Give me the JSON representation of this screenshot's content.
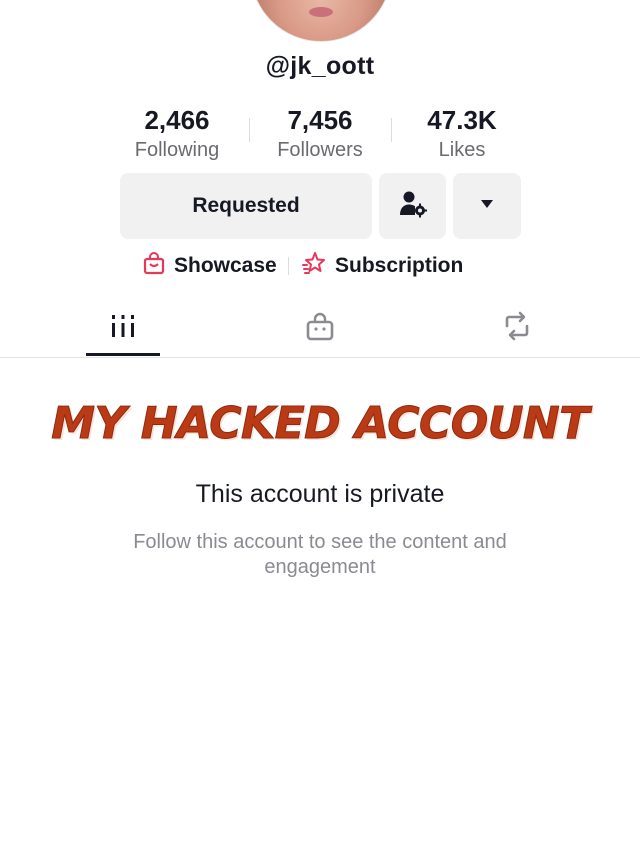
{
  "profile": {
    "username": "@jk_oott"
  },
  "stats": [
    {
      "value": "2,466",
      "label": "Following"
    },
    {
      "value": "7,456",
      "label": "Followers"
    },
    {
      "value": "47.3K",
      "label": "Likes"
    }
  ],
  "actions": {
    "requested_label": "Requested",
    "friend_settings_icon": "person-gear-icon",
    "more_icon": "caret-down-icon"
  },
  "links": {
    "showcase_label": "Showcase",
    "subscription_label": "Subscription",
    "showcase_color": "#e8385a",
    "subscription_color": "#e8385a"
  },
  "tabs": [
    {
      "icon": "videos-grid-icon",
      "active": true
    },
    {
      "icon": "shop-bag-icon",
      "active": false
    },
    {
      "icon": "repost-icon",
      "active": false
    }
  ],
  "overlay": {
    "caption": "MY HACKED ACCOUNT",
    "color": "#bb3a16"
  },
  "private_notice": {
    "title": "This account is private",
    "description": "Follow this account to see the content and engagement"
  }
}
